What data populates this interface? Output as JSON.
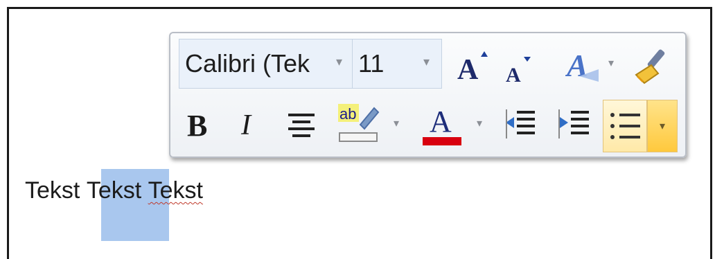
{
  "toolbar": {
    "font_name": "Calibri (Tek",
    "font_size": "11",
    "bold_glyph": "B",
    "italic_glyph": "I",
    "fontcolor_glyph": "A",
    "grow_glyph": "A",
    "shrink_glyph": "A",
    "styles_glyph": "A",
    "highlight_label": "ab",
    "dropdown_glyph": "▾",
    "highlight_color": "#e8e000",
    "font_color": "#d8000f"
  },
  "document": {
    "words": [
      "Tekst",
      "Tekst",
      "Tekst"
    ],
    "selection_color": "#a9c7ee"
  },
  "icons": [
    "grow-font-icon",
    "shrink-font-icon",
    "styles-icon",
    "format-painter-icon",
    "bold-icon",
    "italic-icon",
    "align-center-icon",
    "highlight-icon",
    "font-color-icon",
    "decrease-indent-icon",
    "increase-indent-icon",
    "bullets-icon"
  ]
}
